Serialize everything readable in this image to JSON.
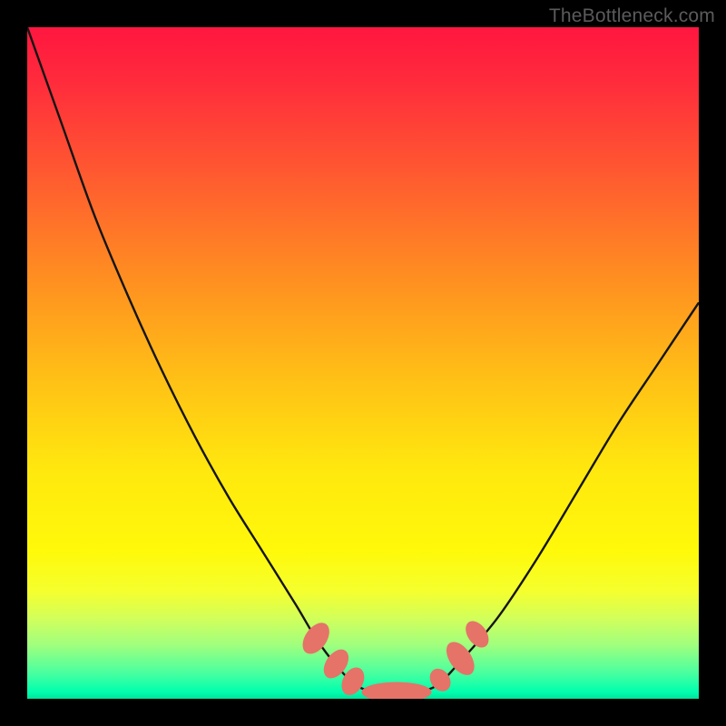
{
  "watermark": {
    "text": "TheBottleneck.com"
  },
  "colors": {
    "background": "#000000",
    "curve_stroke": "#141414",
    "marker_fill": "#e57368",
    "gradient_top": "#ff163f",
    "gradient_bottom": "#00ffae"
  },
  "chart_data": {
    "type": "line",
    "title": "",
    "xlabel": "",
    "ylabel": "",
    "xlim": [
      0,
      100
    ],
    "ylim": [
      0,
      100
    ],
    "grid": false,
    "legend": false,
    "series": [
      {
        "name": "bottleneck-curve",
        "x": [
          0,
          5,
          10,
          15,
          20,
          25,
          30,
          35,
          40,
          43,
          46,
          49,
          52,
          55,
          58,
          61,
          64,
          70,
          76,
          82,
          88,
          94,
          100
        ],
        "y": [
          100,
          86,
          72,
          60,
          49,
          39,
          30,
          22,
          14,
          9,
          5,
          2,
          1,
          1,
          1,
          2,
          5,
          12,
          21,
          31,
          41,
          50,
          59
        ]
      }
    ],
    "markers": [
      {
        "name": "left-high",
        "x": 43.0,
        "y": 9.0,
        "rx": 1.6,
        "ry": 2.6,
        "rot": 35
      },
      {
        "name": "left-mid",
        "x": 46.0,
        "y": 5.2,
        "rx": 1.5,
        "ry": 2.4,
        "rot": 35
      },
      {
        "name": "left-low",
        "x": 48.5,
        "y": 2.6,
        "rx": 1.5,
        "ry": 2.2,
        "rot": 28
      },
      {
        "name": "bottom-bar",
        "x": 55.0,
        "y": 1.0,
        "rx": 5.2,
        "ry": 1.5,
        "rot": 0
      },
      {
        "name": "right-low",
        "x": 61.5,
        "y": 2.8,
        "rx": 1.4,
        "ry": 1.8,
        "rot": -35
      },
      {
        "name": "right-mid",
        "x": 64.5,
        "y": 6.0,
        "rx": 1.6,
        "ry": 2.8,
        "rot": -35
      },
      {
        "name": "right-high",
        "x": 67.0,
        "y": 9.6,
        "rx": 1.4,
        "ry": 2.2,
        "rot": -35
      }
    ]
  }
}
